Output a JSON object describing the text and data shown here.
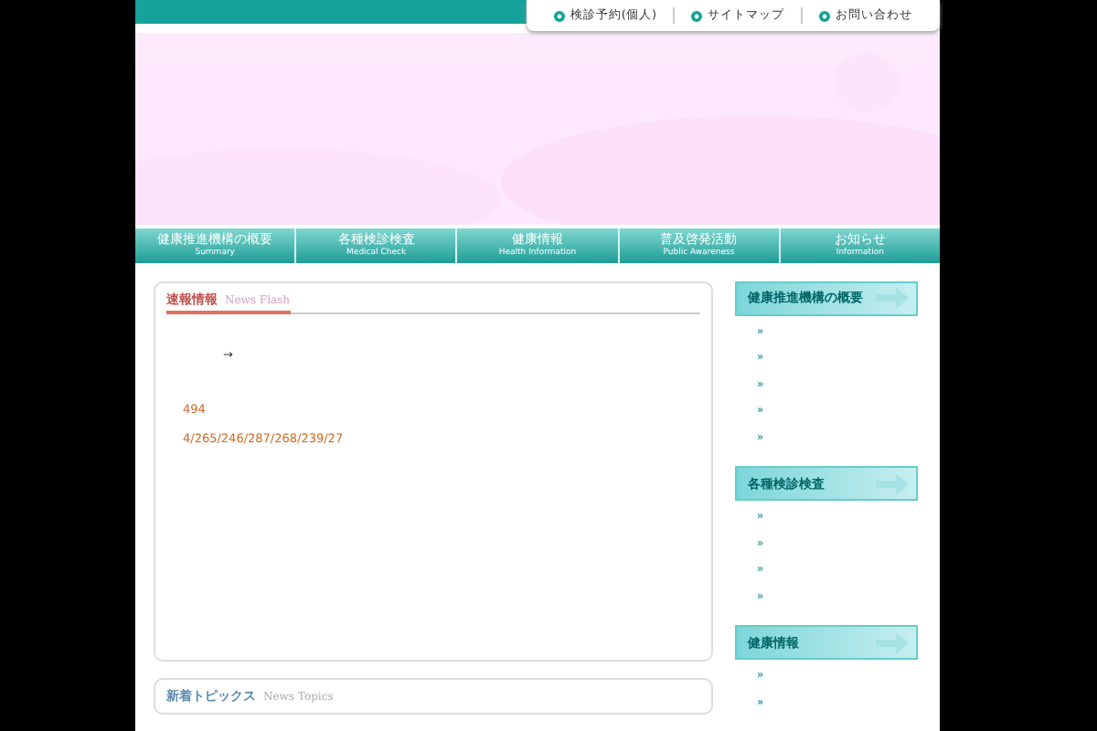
{
  "top_links": [
    {
      "label": "検診予約(個人)"
    },
    {
      "label": "サイトマップ"
    },
    {
      "label": "お問い合わせ"
    }
  ],
  "nav": [
    {
      "label": "健康推進機構の概要",
      "sub": "Summary"
    },
    {
      "label": "各種検診検査",
      "sub": "Medical Check"
    },
    {
      "label": "健康情報",
      "sub": "Health Information"
    },
    {
      "label": "普及啓発活動",
      "sub": "Public Awareness"
    },
    {
      "label": "お知らせ",
      "sub": "Information"
    }
  ],
  "news_flash": {
    "title": "速報情報",
    "subtitle": "News Flash",
    "lines": [
      "→",
      "494",
      "4/265/246/287/268/239/27"
    ]
  },
  "topics": {
    "title": "新着トピックス",
    "subtitle": "News Topics"
  },
  "sidebar": [
    {
      "title": "健康推進機構の概要",
      "items": [
        "»",
        "»",
        "»",
        "»",
        "»"
      ]
    },
    {
      "title": "各種検診検査",
      "items": [
        "»",
        "»",
        "»",
        "»"
      ]
    },
    {
      "title": "健康情報",
      "items": [
        "»",
        "»"
      ]
    }
  ]
}
